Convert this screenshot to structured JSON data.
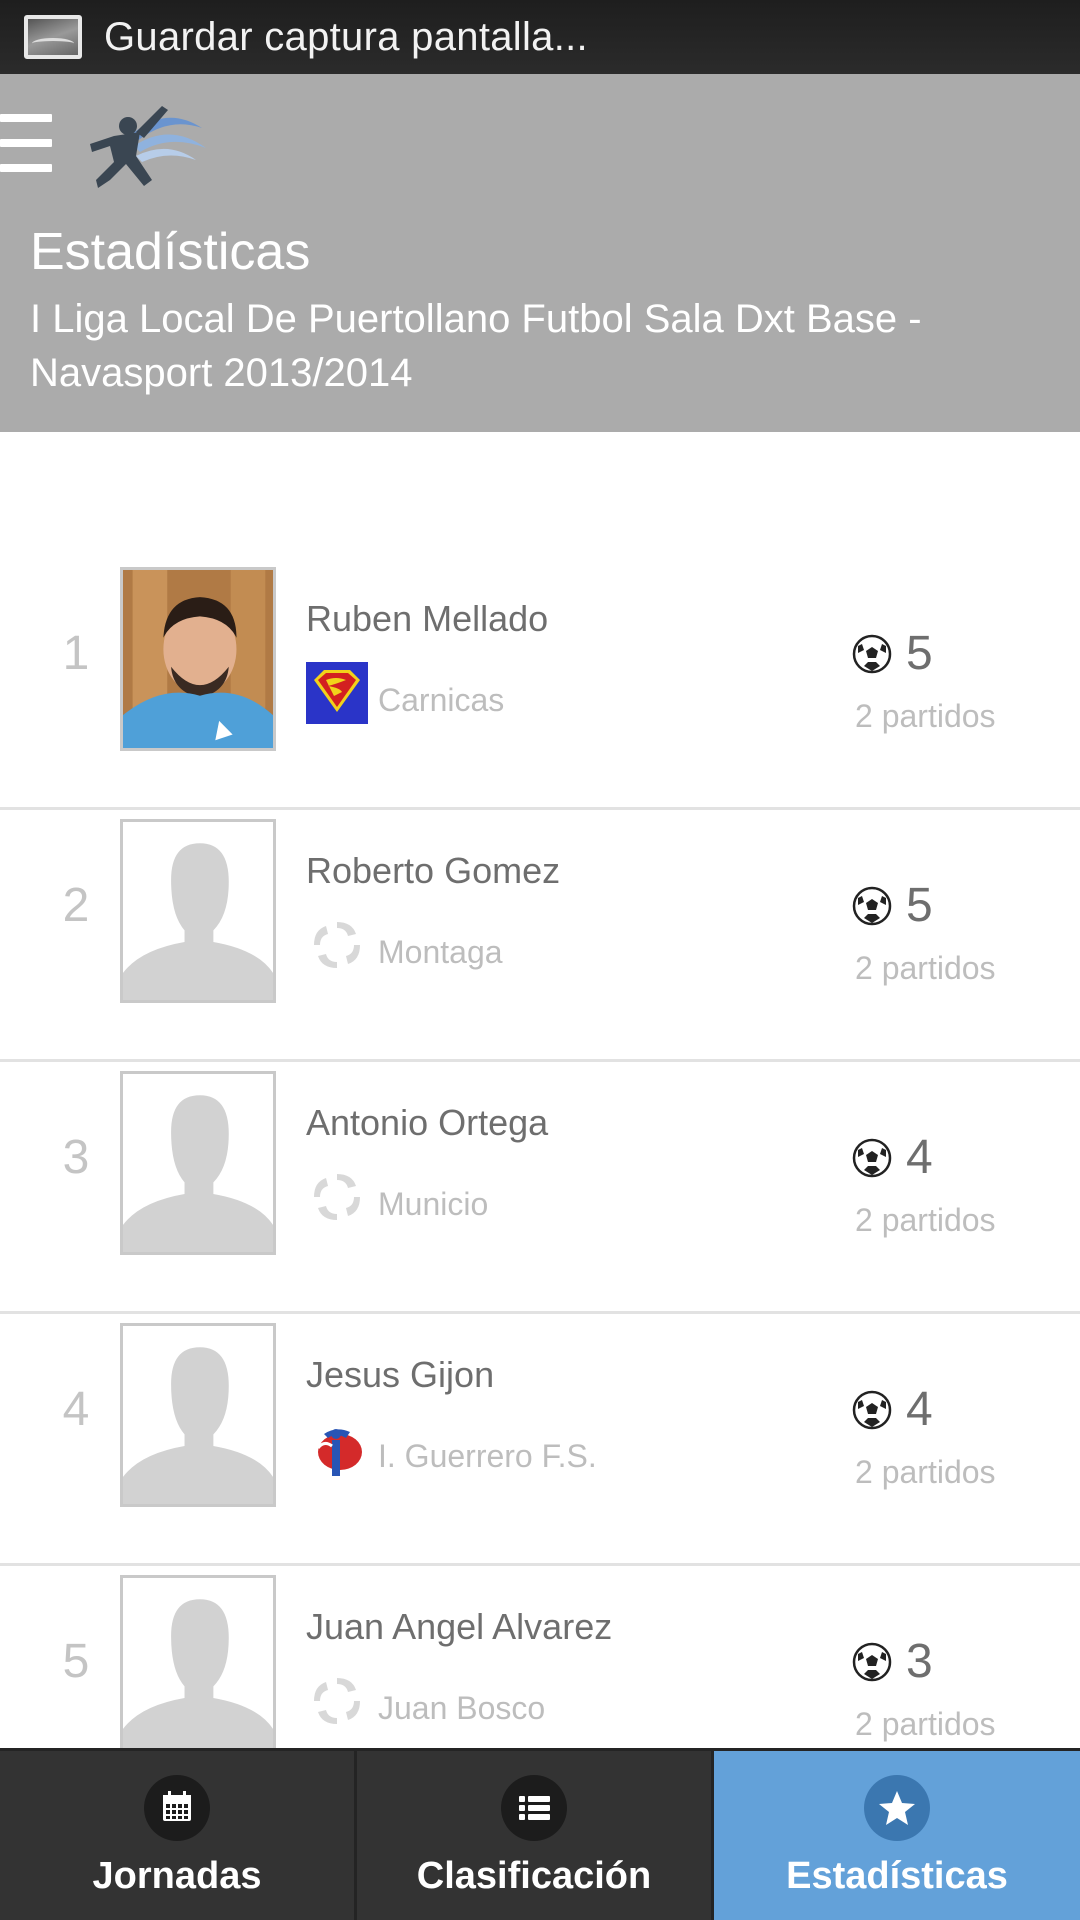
{
  "status_bar": {
    "text": "Guardar captura pantalla...",
    "icon": "screenshot-icon"
  },
  "header": {
    "menu_icon": "hamburger-menu-icon",
    "logo_icon": "soccer-player-logo-icon",
    "title": "Estadísticas",
    "subtitle": "I Liga Local De Puertollano Futbol Sala Dxt Base - Navasport 2013/2014",
    "background_color": "#ababab"
  },
  "players": [
    {
      "rank": "1",
      "name": "Ruben Mellado",
      "team": "Carnicas",
      "team_logo": "superman-crest-icon",
      "photo": "player-photo",
      "goals": "5",
      "matches": "2 partidos"
    },
    {
      "rank": "2",
      "name": "Roberto Gomez",
      "team": "Montaga",
      "team_logo": "generic-team-icon",
      "photo": "placeholder-avatar",
      "goals": "5",
      "matches": "2 partidos"
    },
    {
      "rank": "3",
      "name": "Antonio Ortega",
      "team": "Municio",
      "team_logo": "generic-team-icon",
      "photo": "placeholder-avatar",
      "goals": "4",
      "matches": "2 partidos"
    },
    {
      "rank": "4",
      "name": "Jesus Gijon",
      "team": "I. Guerrero F.S.",
      "team_logo": "guerrero-crest-icon",
      "photo": "placeholder-avatar",
      "goals": "4",
      "matches": "2 partidos"
    },
    {
      "rank": "5",
      "name": "Juan Angel Alvarez",
      "team": "Juan Bosco",
      "team_logo": "generic-team-icon",
      "photo": "placeholder-avatar",
      "goals": "3",
      "matches": "2 partidos"
    }
  ],
  "tabs": [
    {
      "label": "Jornadas",
      "icon": "calendar-icon",
      "active": false
    },
    {
      "label": "Clasificación",
      "icon": "list-icon",
      "active": false
    },
    {
      "label": "Estadísticas",
      "icon": "star-icon",
      "active": true
    }
  ],
  "colors": {
    "active_tab": "#63a1d9",
    "tab_bar": "#333333",
    "status_bar": "#222222"
  }
}
